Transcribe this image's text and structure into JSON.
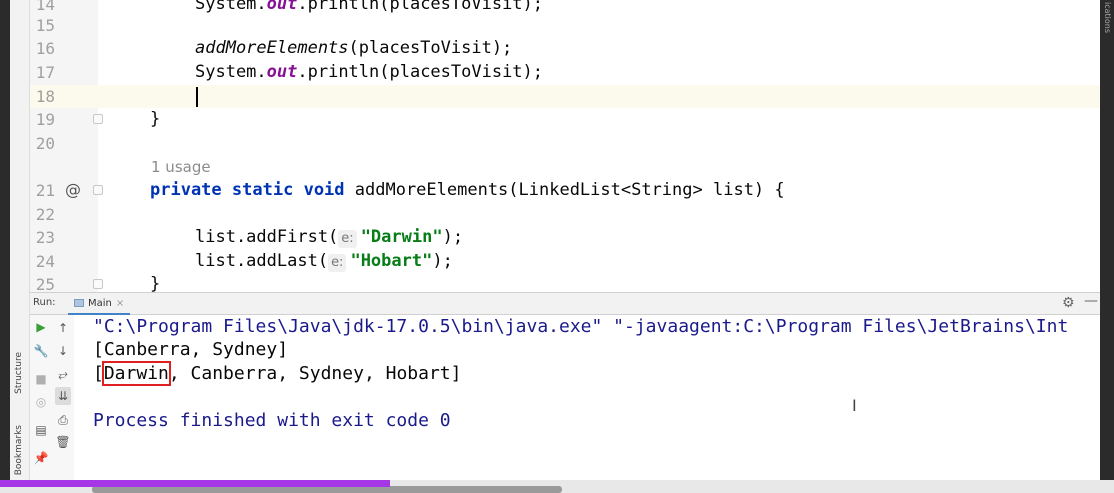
{
  "side_panel": {
    "structure_label": "Structure",
    "bookmarks_label": "Bookmarks",
    "right_label": "ications"
  },
  "editor": {
    "lines": [
      {
        "num": "14",
        "text": "System.out.println(placesToVisit);"
      },
      {
        "num": "15"
      },
      {
        "num": "16"
      },
      {
        "num": "17"
      },
      {
        "num": "18"
      },
      {
        "num": "19"
      },
      {
        "num": "20"
      },
      {
        "num": "21"
      },
      {
        "num": "22"
      },
      {
        "num": "23"
      },
      {
        "num": "24"
      },
      {
        "num": "25"
      }
    ],
    "l14": {
      "a": "System.",
      "b": "out",
      "c": ".println(placesToVisit);"
    },
    "l16": {
      "a": "addMoreElements",
      "b": "(placesToVisit);"
    },
    "l17": {
      "a": "System.",
      "b": "out",
      "c": ".println(placesToVisit);"
    },
    "l19": "}",
    "usage": "1 usage",
    "l21": {
      "at": "@",
      "k1": "private",
      "k2": "static",
      "k3": "void",
      "rest": " addMoreElements(LinkedList<String> list) {"
    },
    "l23": {
      "a": "list.addFirst(",
      "hint": "e:",
      "str": "\"Darwin\"",
      "end": ");"
    },
    "l24": {
      "a": "list.addLast(",
      "hint": "e:",
      "str": "\"Hobart\"",
      "end": ");"
    },
    "l25": "}"
  },
  "run_panel": {
    "label": "Run:",
    "tab_label": "Main",
    "tab_close": "×",
    "settings_icon": "gear-icon",
    "minimize_icon": "minimize-icon",
    "toolbar_left": [
      "run-icon",
      "wrench-icon",
      "stop-icon",
      "camera-icon",
      "layout-icon",
      "pin-icon"
    ],
    "toolbar_right": [
      "up-arrow-icon",
      "down-arrow-icon",
      "soft-wrap-icon",
      "scroll-to-end-icon",
      "print-icon",
      "trash-icon"
    ]
  },
  "console": {
    "line1": "\"C:\\Program Files\\Java\\jdk-17.0.5\\bin\\java.exe\" \"-javaagent:C:\\Program Files\\JetBrains\\Int",
    "line2": "[Canberra, Sydney]",
    "line3": {
      "open": "[",
      "highlight": "Darwin",
      "rest": ", Canberra, Sydney, Hobart]"
    },
    "line5": "Process finished with exit code 0"
  },
  "colors": {
    "keyword": "#0033b3",
    "string": "#067d17",
    "static_field": "#871094",
    "highlight_box": "#e02020",
    "progress": "#a537e6"
  }
}
